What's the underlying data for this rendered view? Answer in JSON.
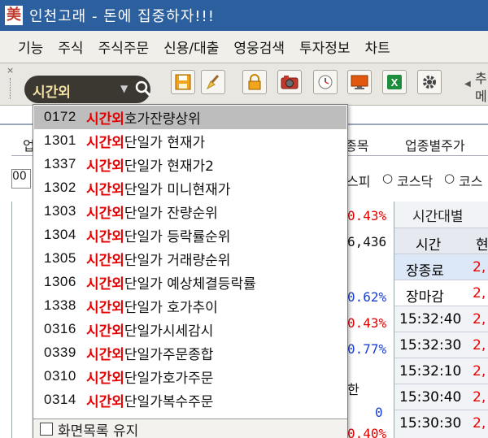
{
  "window": {
    "icon_glyph": "美",
    "title": "인천고래 - 돈에 집중하자!!!"
  },
  "menu": [
    "기능",
    "주식",
    "주식주문",
    "신용/대출",
    "영웅검색",
    "투자정보",
    "차트"
  ],
  "toolbar": {
    "screen_combo_value": "시간외",
    "close_glyph": "×",
    "icons": [
      "save-icon",
      "broom-icon",
      "lock-icon",
      "camera-icon",
      "clock-icon",
      "monitor-icon",
      "excel-icon",
      "gear-icon"
    ],
    "more_label": "추\n메"
  },
  "background": {
    "tabs": [
      "업",
      "종목",
      "업종별주가"
    ],
    "filters": [
      "00",
      "스피",
      "코스닥",
      "코스"
    ],
    "values": [
      "0.43%",
      "6,436",
      "0.62%",
      "0.43%",
      "0.77%",
      "한",
      "0",
      "0.40%"
    ],
    "right_header": "시간대별",
    "right_col_header": "시간",
    "right_col_header2": "현",
    "right_rows": [
      "장종료",
      "장마감",
      "15:32:40",
      "15:32:30",
      "15:32:10",
      "15:30:40",
      "15:30:30"
    ],
    "right_values": [
      "2,",
      "2,",
      "2,",
      "2,",
      "2,",
      "2,",
      "2,"
    ]
  },
  "dropdown": {
    "items": [
      {
        "code": "0172",
        "prefix": "시간외",
        "label": "호가잔량상위"
      },
      {
        "code": "1301",
        "prefix": "시간외",
        "label": "단일가 현재가"
      },
      {
        "code": "1337",
        "prefix": "시간외",
        "label": "단일가 현재가2"
      },
      {
        "code": "1302",
        "prefix": "시간외",
        "label": "단일가 미니현재가"
      },
      {
        "code": "1303",
        "prefix": "시간외",
        "label": "단일가 잔량순위"
      },
      {
        "code": "1304",
        "prefix": "시간외",
        "label": "단일가 등락률순위"
      },
      {
        "code": "1305",
        "prefix": "시간외",
        "label": "단일가 거래량순위"
      },
      {
        "code": "1306",
        "prefix": "시간외",
        "label": "단일가 예상체결등락률"
      },
      {
        "code": "1338",
        "prefix": "시간외",
        "label": "단일가 호가추이"
      },
      {
        "code": "0316",
        "prefix": "시간외",
        "label": "단일가시세감시"
      },
      {
        "code": "0339",
        "prefix": "시간외",
        "label": "단일가주문종합"
      },
      {
        "code": "0310",
        "prefix": "시간외",
        "label": "단일가호가주문"
      },
      {
        "code": "0314",
        "prefix": "시간외",
        "label": "단일가복수주문"
      }
    ],
    "selected_index": 0,
    "footer_label": "화면목록 유지"
  },
  "colors": {
    "title_bar": "#2b5f9e",
    "highlight_red": "#e60000",
    "selected_row": "#bdbdbd"
  }
}
